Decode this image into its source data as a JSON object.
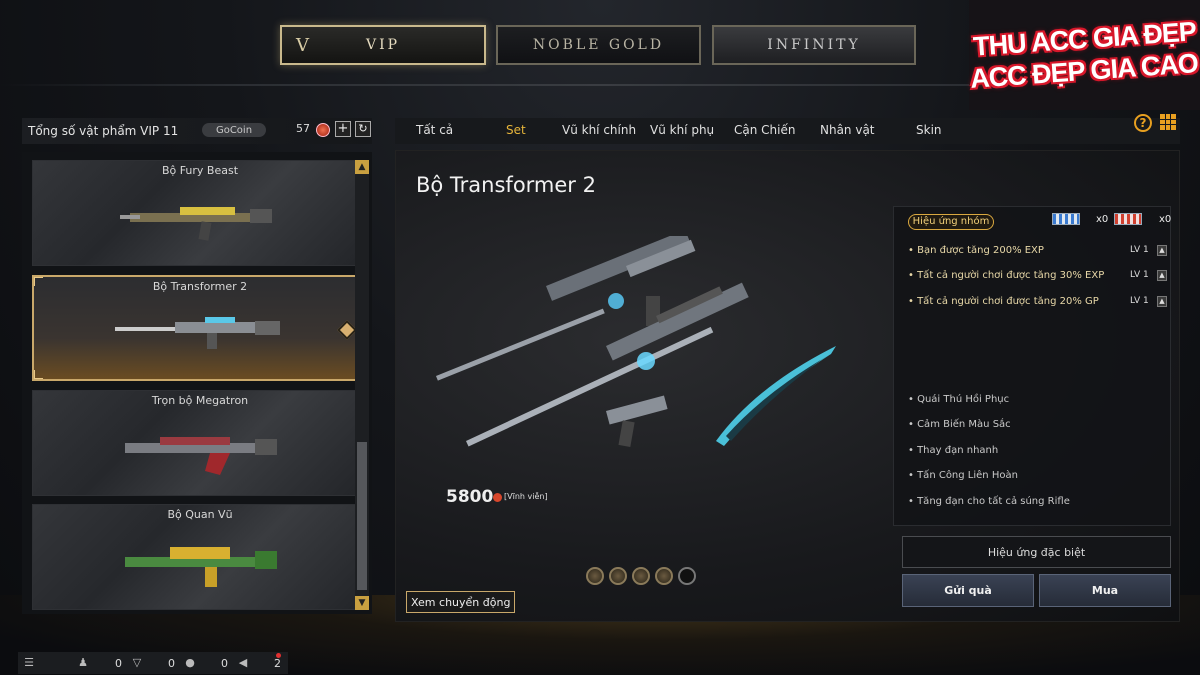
{
  "tiers": [
    {
      "label": "VIP",
      "icon": "V"
    },
    {
      "label": "NOBLE GOLD"
    },
    {
      "label": "INFINITY"
    }
  ],
  "promo": {
    "line1": "THU ACC GIA ĐẸP",
    "line2": "ACC ĐẸP GIA CAO"
  },
  "left_panel": {
    "title": "Tổng số vật phẩm VIP 11",
    "gocoin": "GoCoin",
    "count": "57",
    "plus": "+",
    "refresh": "↻"
  },
  "items": [
    {
      "name": "Bộ Fury Beast"
    },
    {
      "name": "Bộ Transformer 2"
    },
    {
      "name": "Trọn bộ Megatron"
    },
    {
      "name": "Bộ Quan Vũ"
    }
  ],
  "tabs": [
    "Tất cả",
    "Set",
    "Vũ khí chính",
    "Vũ khí phụ",
    "Cận Chiến",
    "Nhân vật",
    "Skin"
  ],
  "active_tab": "Set",
  "detail": {
    "title": "Bộ Transformer 2",
    "price": "5800",
    "price_note": "[Vĩnh viễn]",
    "motion_button": "Xem chuyển động",
    "group_effect_label": "Hiệu ứng nhóm",
    "badge_count_1": "x0",
    "badge_count_2": "x0",
    "effects": [
      {
        "text": "• Bạn được tăng 200%  EXP",
        "lv": "LV 1"
      },
      {
        "text": "• Tất cả người chơi được tăng 30% EXP",
        "lv": "LV 1"
      },
      {
        "text": "• Tất cả người chơi được tăng 20% GP",
        "lv": "LV 1"
      }
    ],
    "skills": [
      "• Quái Thú Hồi Phục",
      "• Cảm Biến Màu Sắc",
      "• Thay đạn nhanh",
      "• Tấn Công Liên Hoàn",
      "• Tăng đạn cho tất cả súng Rifle"
    ],
    "special_effect": "Hiệu ứng đặc biệt",
    "gift_button": "Gửi quà",
    "buy_button": "Mua"
  },
  "bottom_bar": {
    "c1": "0",
    "c2": "0",
    "c3": "0",
    "c4": "2"
  },
  "colors": {
    "accent": "#e6b43a",
    "gold_border": "#c9a86a"
  }
}
